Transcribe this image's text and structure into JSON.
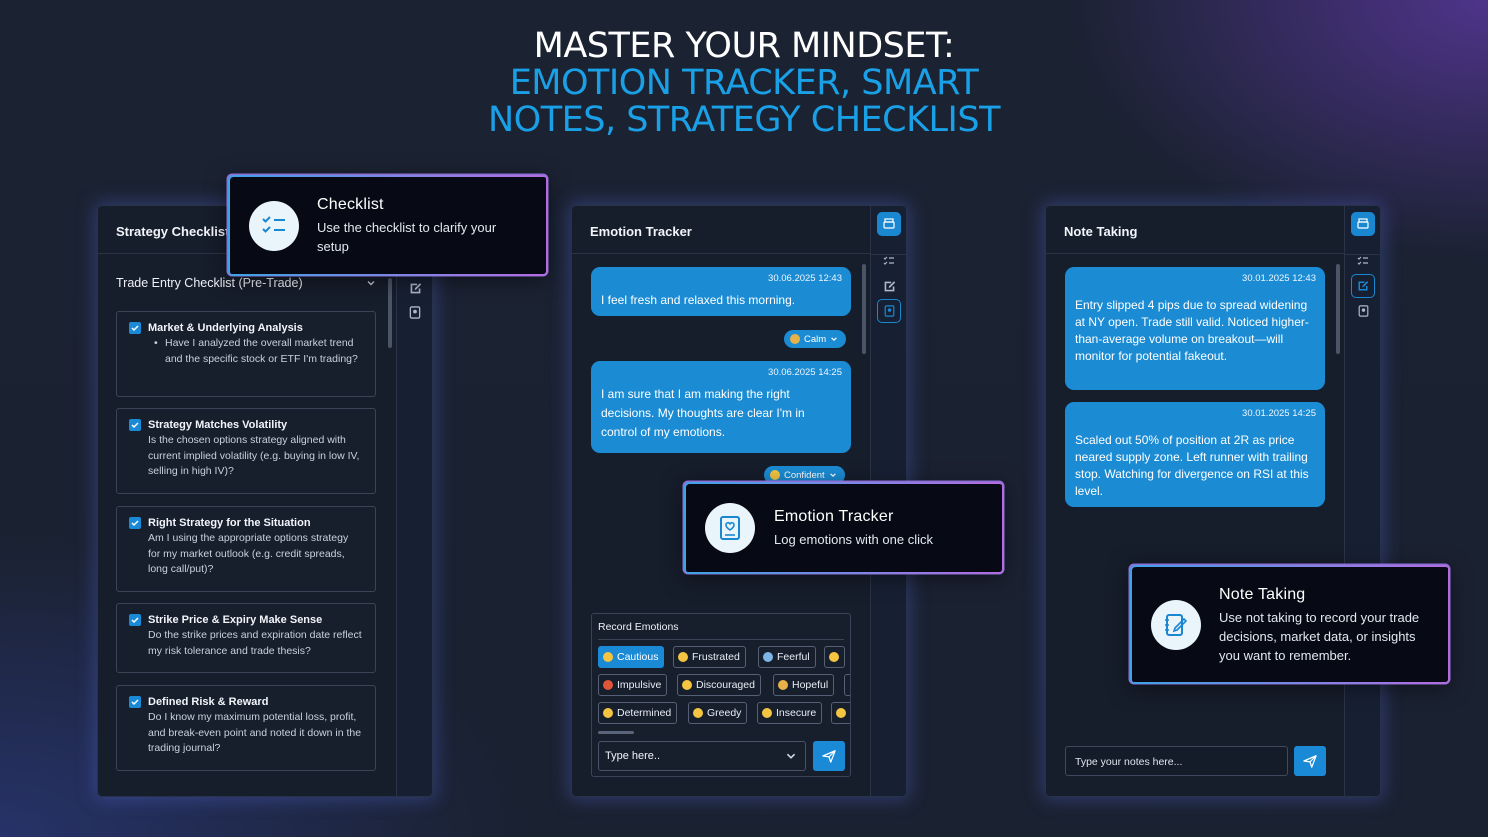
{
  "headline": {
    "line1": "MASTER YOUR MINDSET:",
    "line2": "EMOTION TRACKER, SMART",
    "line3": "NOTES, STRATEGY CHECKLIST"
  },
  "checklist_panel": {
    "title": "Strategy Checklist",
    "section": "Trade Entry Checklist (Pre-Trade)",
    "items": [
      {
        "title": "Market & Underlying Analysis",
        "body": "Have I analyzed the overall market trend and the specific stock or ETF I'm trading?"
      },
      {
        "title": "Strategy Matches Volatility",
        "body": "Is the chosen options strategy aligned with current implied volatility (e.g. buying in low IV, selling in high IV)?"
      },
      {
        "title": "Right Strategy for the Situation",
        "body": "Am I using the appropriate options strategy for my market outlook (e.g. credit spreads, long call/put)?"
      },
      {
        "title": "Strike Price & Expiry Make Sense",
        "body": "Do the strike prices and expiration date reflect my risk tolerance and trade thesis?"
      },
      {
        "title": "Defined Risk & Reward",
        "body": "Do I know my maximum potential loss, profit, and break-even point and noted it down in the trading journal?"
      }
    ]
  },
  "emotion_panel": {
    "title": "Emotion Tracker",
    "messages": [
      {
        "timestamp": "30.06.2025 12:43",
        "text": "I feel fresh and relaxed this morning.",
        "tag": "Calm"
      },
      {
        "timestamp": "30.06.2025 14:25",
        "text": "I am sure that I am making the right decisions. My thoughts are clear I'm in control of my emotions.",
        "tag": "Confident"
      }
    ],
    "record_title": "Record Emotions",
    "emotion_rows": [
      [
        "Cautious",
        "Frustrated",
        "Feerful"
      ],
      [
        "Impulsive",
        "Discouraged",
        "Hopeful"
      ],
      [
        "Determined",
        "Greedy",
        "Insecure"
      ]
    ],
    "active_emotion": "Cautious",
    "input_placeholder": "Type here.."
  },
  "note_panel": {
    "title": "Note Taking",
    "notes": [
      {
        "timestamp": "30.01.2025 12:43",
        "text": "Entry slipped 4 pips due to spread widening at NY open. Trade still valid. Noticed higher-than-average volume on breakout—will monitor for potential fakeout."
      },
      {
        "timestamp": "30.01.2025 14:25",
        "text": "Scaled out 50% of position at 2R as price neared supply zone. Left runner with trailing stop. Watching for divergence on RSI at this level."
      }
    ],
    "input_placeholder": "Type your notes here..."
  },
  "tooltips": {
    "checklist": {
      "title": "Checklist",
      "desc": "Use the checklist to clarify your setup"
    },
    "emotion": {
      "title": "Emotion Tracker",
      "desc": "Log emotions with one click"
    },
    "notes": {
      "title": "Note Taking",
      "desc": "Use not taking to record your trade decisions, market data, or insights you want to remember."
    }
  },
  "colors": {
    "accent": "#1a8ad6",
    "headline_blue": "#1aa0e6",
    "panel_bg": "#161d2b"
  }
}
